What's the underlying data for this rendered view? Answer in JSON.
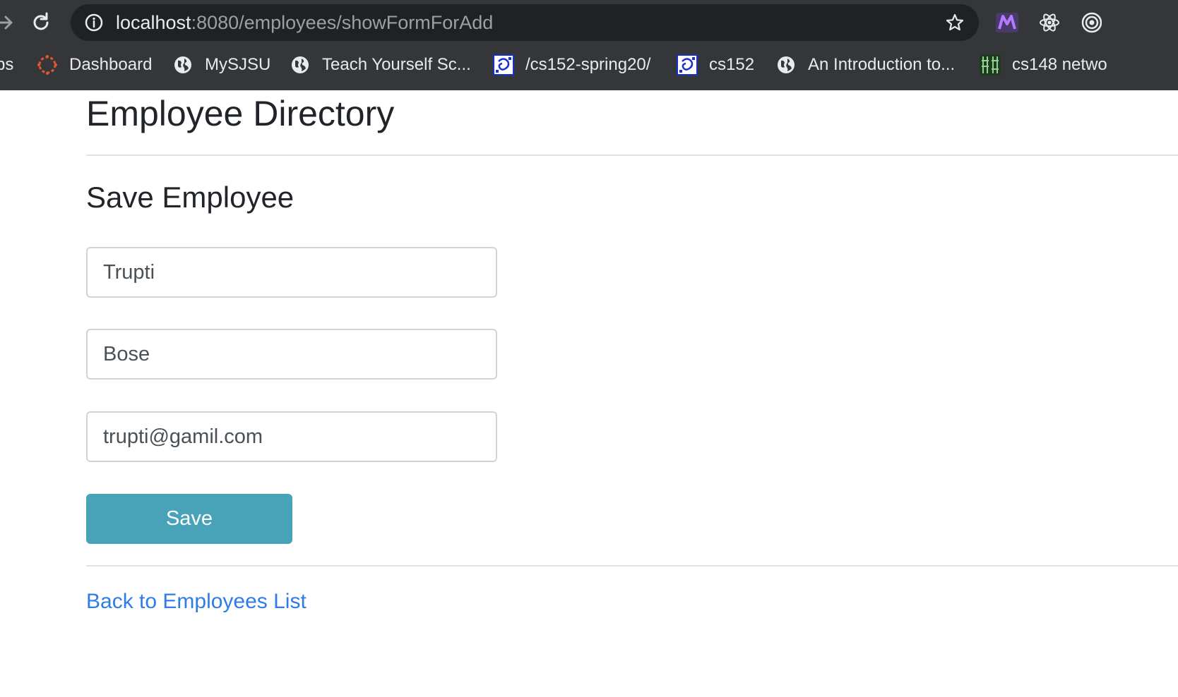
{
  "browser": {
    "url_host": "localhost",
    "url_path": ":8080/employees/showFormForAdd",
    "bookmarks": [
      {
        "label": "ps",
        "icon": "apps-icon"
      },
      {
        "label": "Dashboard",
        "icon": "canvas-icon"
      },
      {
        "label": "MySJSU",
        "icon": "globe-icon"
      },
      {
        "label": "Teach Yourself Sc...",
        "icon": "globe-icon"
      },
      {
        "label": "/cs152-spring20/",
        "icon": "site-favicon-icon"
      },
      {
        "label": "cs152",
        "icon": "site-favicon-icon"
      },
      {
        "label": "An Introduction to...",
        "icon": "globe-icon"
      },
      {
        "label": "cs148 netwo",
        "icon": "grid-favicon-icon"
      }
    ],
    "extensions": [
      "m-extension-icon",
      "react-devtools-icon",
      "target-extension-icon"
    ]
  },
  "page": {
    "title": "Employee Directory",
    "section_title": "Save Employee",
    "form": {
      "first_name": "Trupti",
      "last_name": "Bose",
      "email": "trupti@gamil.com",
      "save_label": "Save"
    },
    "back_link": "Back to Employees List"
  },
  "colors": {
    "save_button": "#49a3b8",
    "link": "#2f7ce6",
    "chrome_bg": "#35363a"
  }
}
